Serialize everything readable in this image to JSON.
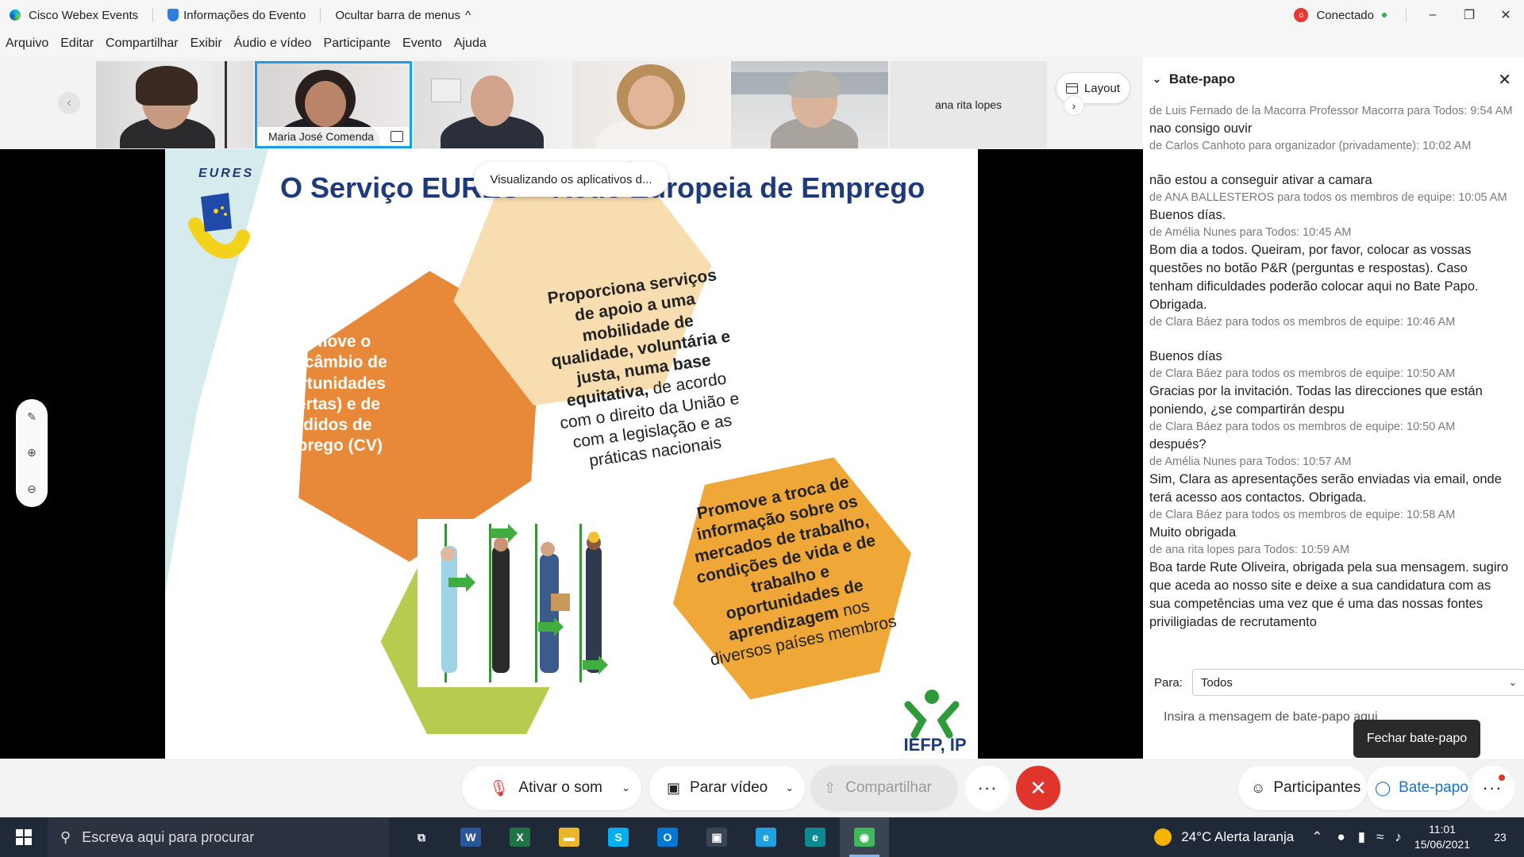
{
  "titlebar": {
    "app_name": "Cisco Webex Events",
    "event_info": "Informações do Evento",
    "hide_menu": "Ocultar barra de menus",
    "hide_menu_chevron": "^",
    "connection_icon_text": "o",
    "connected": "Conectado",
    "minimize": "–",
    "restore": "❐",
    "close": "✕"
  },
  "menubar": {
    "items": [
      "Arquivo",
      "Editar",
      "Compartilhar",
      "Exibir",
      "Áudio e vídeo",
      "Participante",
      "Evento",
      "Ajuda"
    ]
  },
  "video_strip": {
    "prev_arrow": "‹",
    "participants": [
      {
        "name": ""
      },
      {
        "name": "Maria José Comenda"
      },
      {
        "name": ""
      },
      {
        "name": ""
      },
      {
        "name": ""
      },
      {
        "name": "ana rita lopes"
      }
    ],
    "layout_label": "Layout",
    "next_arrow": "›"
  },
  "stage": {
    "tooltip": "Visualizando os aplicativos d...",
    "slide": {
      "logo_text": "EURES",
      "title": "O Serviço EURES – Rede Europeia de Emprego",
      "hex_left": "Promove o intercâmbio de oportunidades (ofertas) e de pedidos de emprego (CV)",
      "hex_top_bold": "Proporciona serviços de apoio a uma mobilidade de qualidade, voluntária e justa, numa base equitativa,",
      "hex_top_rest": " de acordo com o direito da União e com a legislação e as práticas nacionais",
      "hex_right_bold": "Promove a troca de informação sobre os mercados de trabalho, condições de vida e de trabalho e oportunidades de aprendizagem",
      "hex_right_rest": " nos diversos países membros",
      "footer_logo": "IEFP, IP"
    },
    "zoom_tools": {
      "annotate": "✎",
      "zoom_in": "⊕",
      "zoom_out": "⊖"
    }
  },
  "chat": {
    "title": "Bate-papo",
    "collapse": "⌄",
    "close": "✕",
    "messages": [
      {
        "meta": "de Luis Fernado de la Macorra Professor Macorra para Todos: 9:54 AM",
        "body": "nao consigo ouvir",
        "gap": false
      },
      {
        "meta": "de Carlos Canhoto para organizador (privadamente):   10:02 AM",
        "body": "não estou a conseguir ativar a camara",
        "gap": false,
        "pre_gap": true
      },
      {
        "meta": "de ANA BALLESTEROS para todos os membros de equipe:   10:05 AM",
        "body": "Buenos días.",
        "gap": false
      },
      {
        "meta": "de Amélia Nunes para Todos:   10:45 AM",
        "body": "Bom dia a todos. Queiram, por favor, colocar as vossas questões no botão P&R (perguntas e respostas). Caso tenham dificuldades poderão colocar aqui no Bate Papo. Obrigada.",
        "gap": false
      },
      {
        "meta": "de Clara Báez para todos os membros de equipe:   10:46 AM",
        "body": "Buenos días",
        "gap": false,
        "pre_gap": true
      },
      {
        "meta": "de Clara Báez para todos os membros de equipe:   10:50 AM",
        "body": "Gracias por la invitación. Todas las direcciones que están poniendo, ¿se compartirán despu",
        "gap": false
      },
      {
        "meta": "de Clara Báez para todos os membros de equipe:   10:50 AM",
        "body": "después?",
        "gap": false
      },
      {
        "meta": "de Amélia Nunes para Todos:   10:57 AM",
        "body": "Sim, Clara as apresentações serão enviadas via email, onde terá acesso aos contactos. Obrigada.",
        "gap": false
      },
      {
        "meta": "de Clara Báez para todos os membros de equipe:   10:58 AM",
        "body": "Muito obrigada",
        "gap": false
      },
      {
        "meta": "de ana rita lopes para Todos:   10:59 AM",
        "body": "Boa tarde Rute Oliveira, obrigada pela sua mensagem. sugiro que aceda ao nosso site e deixe a sua candidatura com as sua competências uma vez que é uma das nossas fontes priviligiadas de recrutamento",
        "gap": false
      }
    ],
    "to_label": "Para:",
    "to_value": "Todos",
    "to_caret": "⌄",
    "input_placeholder": "Insira a mensagem de bate-papo aqui",
    "close_tooltip": "Fechar bate-papo"
  },
  "controls": {
    "mute_label": "Ativar o som",
    "video_label": "Parar vídeo",
    "share_label": "Compartilhar",
    "more": "···",
    "end": "✕",
    "participants_label": "Participantes",
    "chat_label": "Bate-papo",
    "caret": "⌄"
  },
  "taskbar": {
    "search_placeholder": "Escreva aqui para procurar",
    "weather": "24°C  Alerta laranja",
    "time": "11:01",
    "date": "15/06/2021",
    "notifications": "23",
    "apps": [
      {
        "name": "task-view",
        "glyph": "⧉",
        "color": "#1f2937"
      },
      {
        "name": "word",
        "glyph": "W",
        "color": "#2b579a"
      },
      {
        "name": "excel",
        "glyph": "X",
        "color": "#217346"
      },
      {
        "name": "file-explorer",
        "glyph": "▬",
        "color": "#e8b52b"
      },
      {
        "name": "skype",
        "glyph": "S",
        "color": "#00aff0"
      },
      {
        "name": "outlook",
        "glyph": "O",
        "color": "#0078d4"
      },
      {
        "name": "store",
        "glyph": "▣",
        "color": "#3a4453"
      },
      {
        "name": "internet-explorer",
        "glyph": "e",
        "color": "#1ea1e0"
      },
      {
        "name": "edge",
        "glyph": "e",
        "color": "#0c8a8f"
      },
      {
        "name": "webex",
        "glyph": "◉",
        "color": "#41b85c"
      }
    ]
  },
  "colors": {
    "accent": "#1a9ce6",
    "end_call": "#e0352b",
    "slide_title": "#1f3a7a",
    "hex_orange": "#e8893a",
    "hex_cream": "#f7ddb0",
    "hex_green": "#b7cc4e",
    "hex_gold": "#efa838"
  }
}
